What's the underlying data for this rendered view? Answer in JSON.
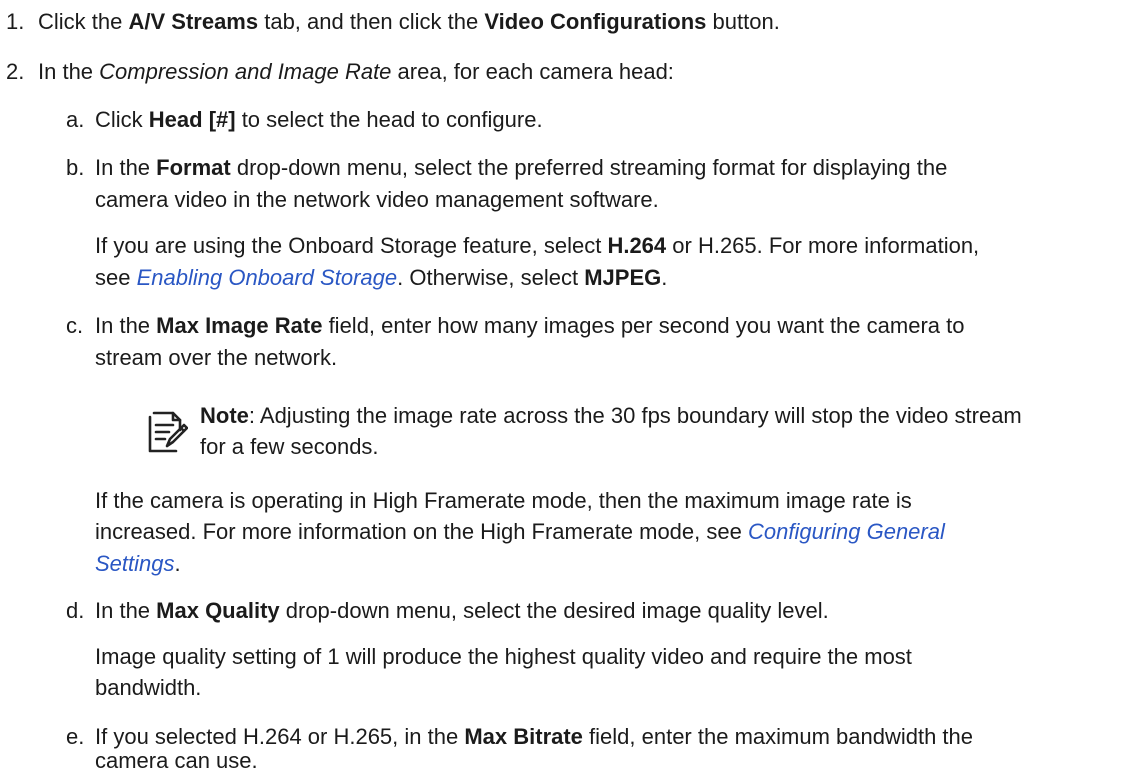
{
  "step1": {
    "number": "1.",
    "p1": "Click the ",
    "b1": "A/V Streams",
    "p2": " tab, and then click the ",
    "b2": "Video Configurations",
    "p3": " button."
  },
  "step2": {
    "number": "2.",
    "p1": "In the ",
    "i1": "Compression and Image Rate",
    "p2": " area, for each camera head:"
  },
  "a": {
    "letter": "a.",
    "p1": "Click ",
    "b1": "Head [#]",
    "p2": " to select the head to configure."
  },
  "b": {
    "letter": "b.",
    "line1_p1": "In the ",
    "line1_b1": "Format",
    "line1_p2": " drop-down menu, select the preferred streaming format for displaying the",
    "line2": "camera video in the network video management software.",
    "para_l1_p1": "If you are using the Onboard Storage feature, select ",
    "para_l1_b1": "H.264",
    "para_l1_p2": " or H.265. For more information,",
    "para_l2_p1": "see ",
    "para_l2_link": "Enabling Onboard Storage",
    "para_l2_p2": ". Otherwise, select ",
    "para_l2_b1": "MJPEG",
    "para_l2_p3": "."
  },
  "c": {
    "letter": "c.",
    "line1_p1": "In the ",
    "line1_b1": "Max Image Rate",
    "line1_p2": " field, enter how many images per second you want the camera to",
    "line2": "stream over the network.",
    "note_label": "Note",
    "note_l1": ": Adjusting the image rate across the 30 fps boundary will stop the video stream",
    "note_l2": "for a few seconds.",
    "para_l1": "If the camera is operating in High Framerate mode, then the maximum image rate is",
    "para_l2_p1": "increased. For more information on the High Framerate mode, see ",
    "para_l2_link": "Configuring General",
    "para_l3_link": "Settings",
    "para_l3_p1": "."
  },
  "d": {
    "letter": "d.",
    "line1_p1": "In the ",
    "line1_b1": "Max Quality",
    "line1_p2": " drop-down menu, select the desired image quality level.",
    "para_l1": "Image quality setting of 1 will produce the highest quality video and require the most",
    "para_l2": "bandwidth."
  },
  "e": {
    "letter": "e.",
    "line1_p1": "If you selected H.264 or H.265, in the ",
    "line1_b1": "Max Bitrate",
    "line1_p2": " field, enter the maximum bandwidth the",
    "line2": "camera can use."
  }
}
